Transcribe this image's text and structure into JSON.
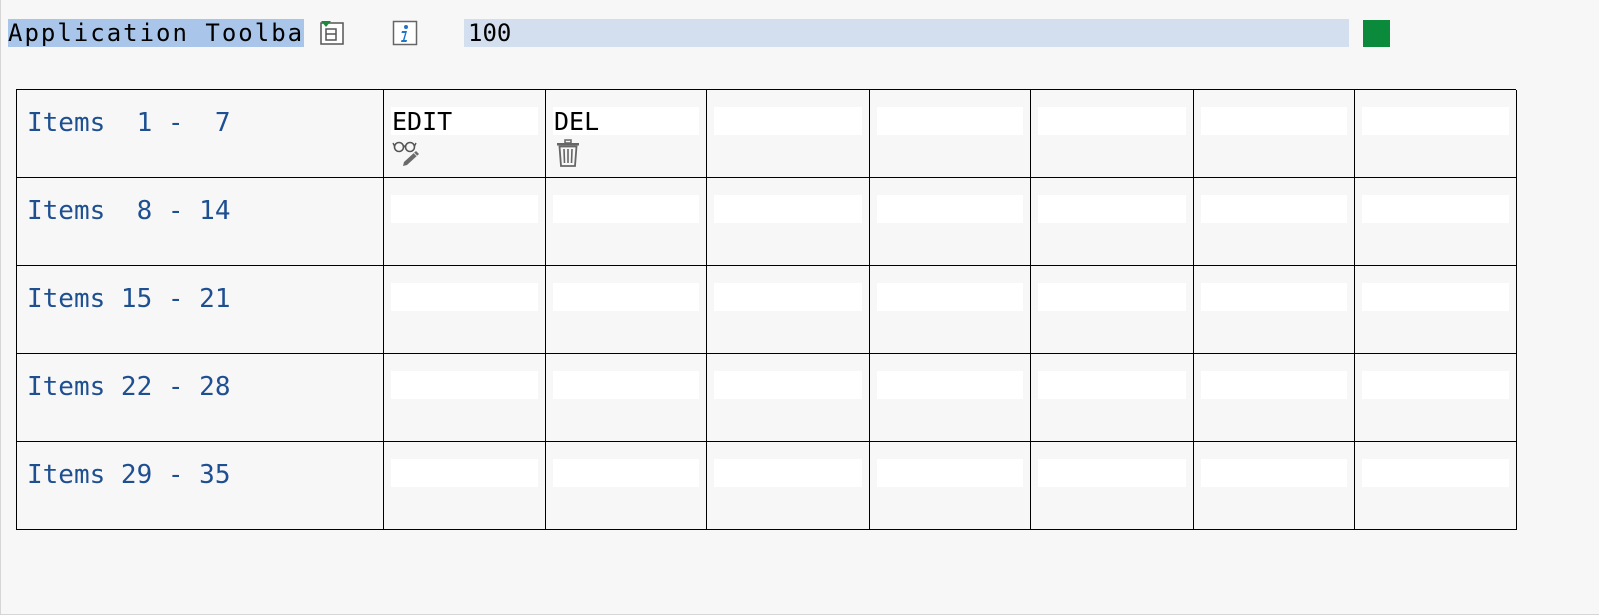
{
  "toolbar": {
    "title": "Application Toolbar",
    "field_value": "100",
    "icons": {
      "left": "layout-icon",
      "info": "info-icon"
    },
    "status_color": "#0a8a3a",
    "title_highlight_color": "#a9c6ea",
    "field_color": "#d3dfee"
  },
  "grid": {
    "rows": [
      {
        "label": "Items  1 -  7"
      },
      {
        "label": "Items  8 - 14"
      },
      {
        "label": "Items 15 - 21"
      },
      {
        "label": "Items 22 - 28"
      },
      {
        "label": "Items 29 - 35"
      }
    ],
    "buttons": [
      {
        "label": "EDIT",
        "icon": "glasses-pencil-icon"
      },
      {
        "label": "DEL",
        "icon": "trash-icon"
      }
    ],
    "label_color": "#1d4f91"
  }
}
